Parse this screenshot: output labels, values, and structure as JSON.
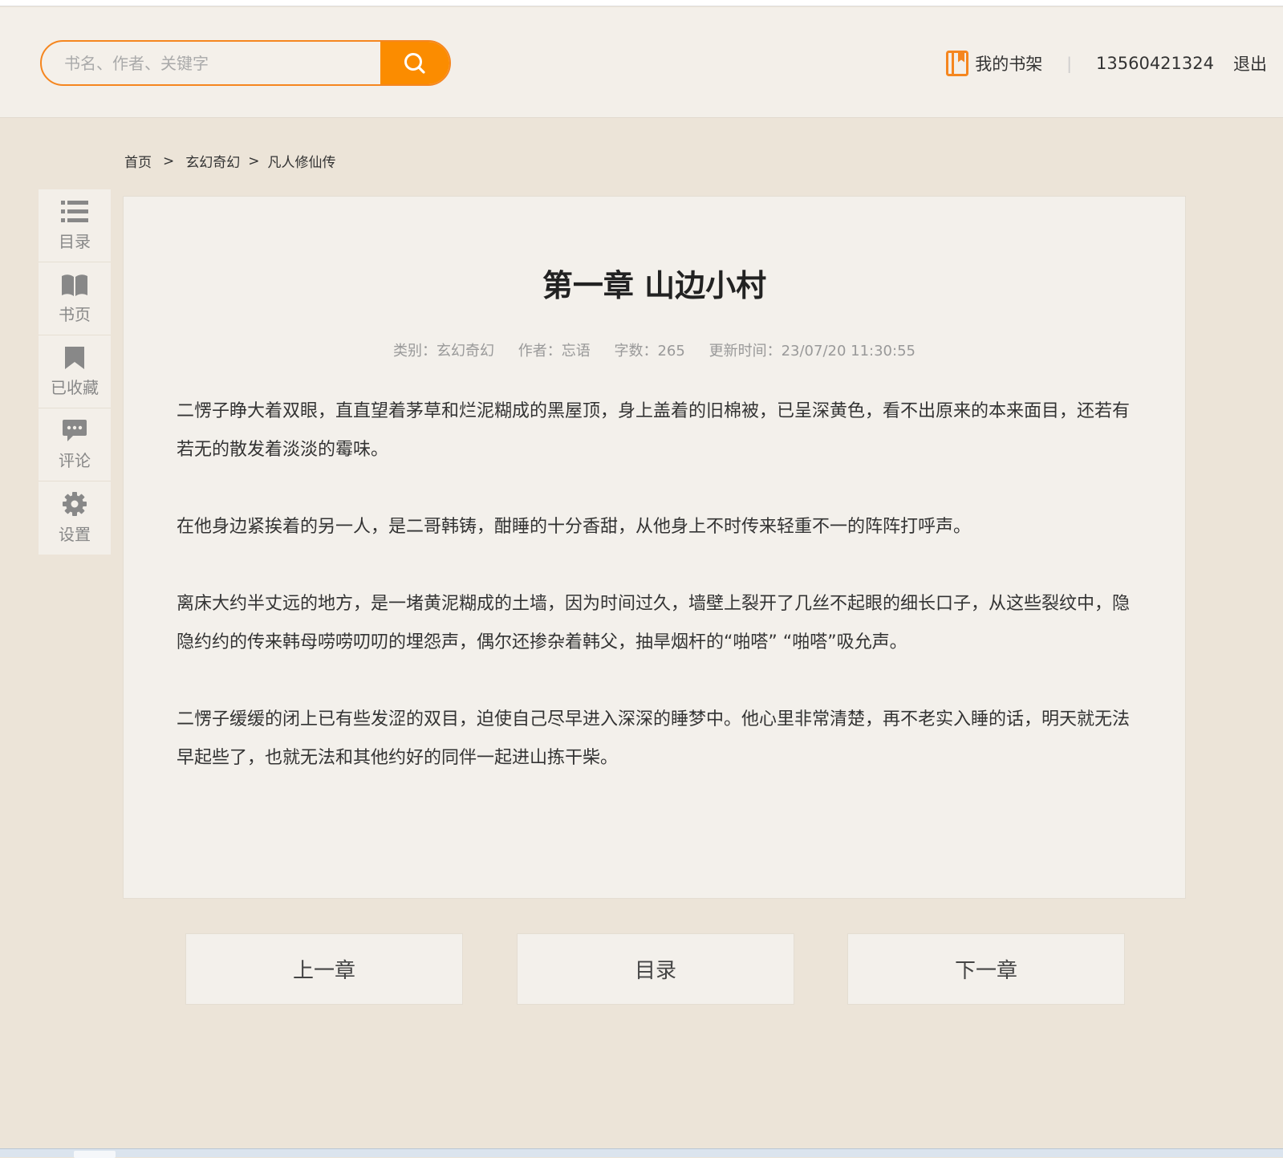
{
  "header": {
    "search_placeholder": "书名、作者、关键字",
    "shelf_label": "我的书架",
    "separator": "|",
    "phone": "13560421324",
    "logout_label": "退出"
  },
  "breadcrumb": {
    "home": "首页",
    "category": "玄幻奇幻",
    "book": "凡人修仙传",
    "separator": ">"
  },
  "sidebar": {
    "items": [
      {
        "label": "目录",
        "icon": "list-icon"
      },
      {
        "label": "书页",
        "icon": "book-icon"
      },
      {
        "label": "已收藏",
        "icon": "bookmark-icon"
      },
      {
        "label": "评论",
        "icon": "comment-icon"
      },
      {
        "label": "设置",
        "icon": "gear-icon"
      }
    ]
  },
  "chapter": {
    "title": "第一章 山边小村",
    "meta": {
      "category": "类别：玄幻奇幻",
      "author": "作者：忘语",
      "word_count": "字数：265",
      "updated": "更新时间：23/07/20 11:30:55"
    },
    "paragraphs": [
      "二愣子睁大着双眼，直直望着茅草和烂泥糊成的黑屋顶，身上盖着的旧棉被，已呈深黄色，看不出原来的本来面目，还若有若无的散发着淡淡的霉味。",
      "在他身边紧挨着的另一人，是二哥韩铸，酣睡的十分香甜，从他身上不时传来轻重不一的阵阵打呼声。",
      "离床大约半丈远的地方，是一堵黄泥糊成的土墙，因为时间过久，墙壁上裂开了几丝不起眼的细长口子，从这些裂纹中，隐隐约约的传来韩母唠唠叨叨的埋怨声，偶尔还掺杂着韩父，抽旱烟杆的“啪嗒”  “啪嗒”吸允声。",
      "二愣子缓缓的闭上已有些发涩的双目，迫使自己尽早进入深深的睡梦中。他心里非常清楚，再不老实入睡的话，明天就无法早起些了，也就无法和其他约好的同伴一起进山拣干柴。"
    ]
  },
  "nav": {
    "prev": "上一章",
    "toc": "目录",
    "next": "下一章"
  },
  "colors": {
    "accent": "#fb8c00",
    "page_bg": "#ece4d8",
    "panel_bg": "#f3f0eb"
  }
}
